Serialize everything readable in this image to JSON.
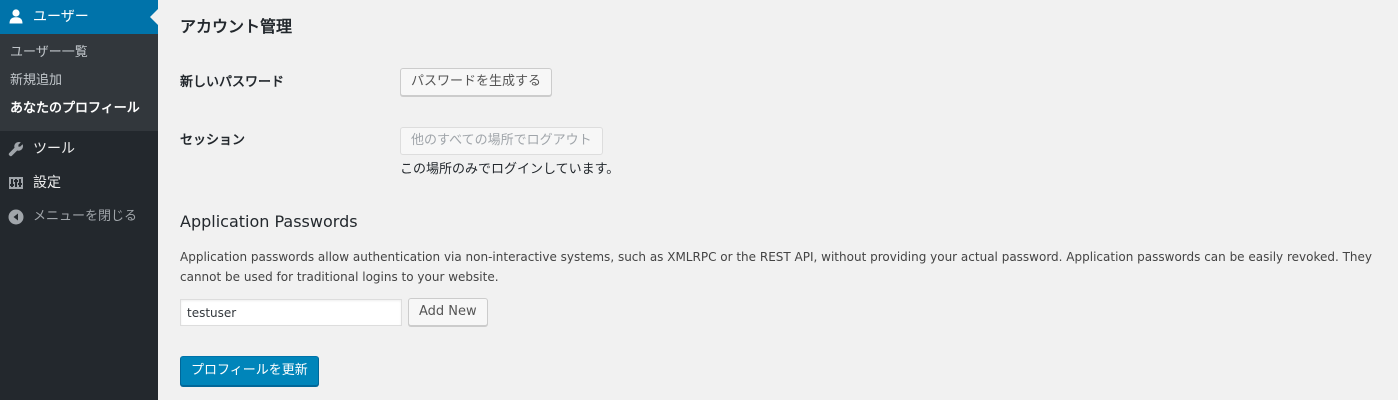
{
  "sidebar": {
    "current_menu": {
      "label": "ユーザー",
      "icon": "user-icon"
    },
    "submenu": [
      {
        "label": "ユーザー一覧",
        "current": false
      },
      {
        "label": "新規追加",
        "current": false
      },
      {
        "label": "あなたのプロフィール",
        "current": true
      }
    ],
    "items": [
      {
        "label": "ツール",
        "icon": "wrench-icon"
      },
      {
        "label": "設定",
        "icon": "settings-icon"
      },
      {
        "label": "メニューを閉じる",
        "icon": "collapse-icon"
      }
    ]
  },
  "main": {
    "section_title": "アカウント管理",
    "new_password": {
      "label": "新しいパスワード",
      "button": "パスワードを生成する"
    },
    "sessions": {
      "label": "セッション",
      "button": "他のすべての場所でログアウト",
      "description": "この場所のみでログインしています。"
    },
    "app_passwords": {
      "title": "Application Passwords",
      "description": "Application passwords allow authentication via non-interactive systems, such as XMLRPC or the REST API, without providing your actual password. Application passwords can be easily revoked. They cannot be used for traditional logins to your website.",
      "input_value": "testuser",
      "add_button": "Add New"
    },
    "submit_button": "プロフィールを更新"
  },
  "colors": {
    "sidebar_bg": "#23282d",
    "submenu_bg": "#32373c",
    "accent": "#0073aa",
    "primary_button": "#0085ba",
    "page_bg": "#f1f1f1"
  }
}
